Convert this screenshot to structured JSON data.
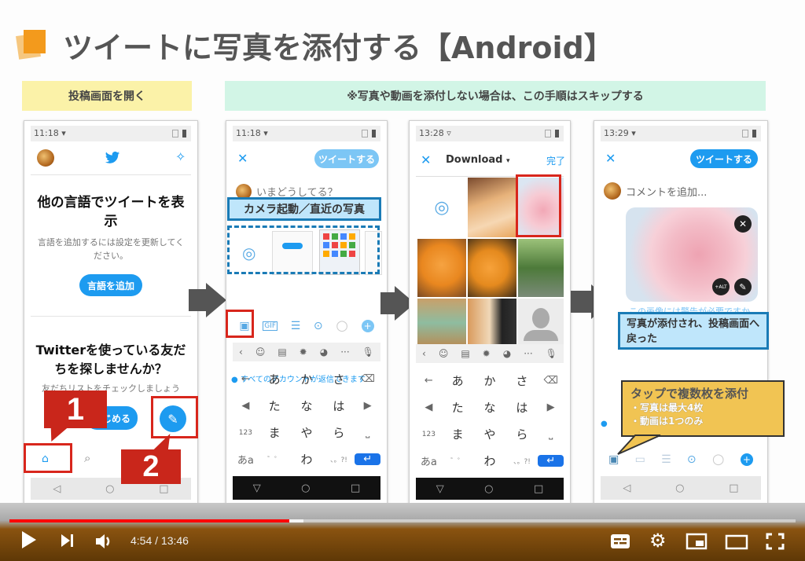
{
  "slide": {
    "title": "ツイートに写真を添付する【Android】",
    "step_banners": {
      "open_compose": "投稿画面を開く",
      "skip_note": "※写真や動画を添付しない場合は、この手順はスキップする"
    }
  },
  "phone1": {
    "status_time": "11:18",
    "card1_title": "他の言語でツイートを表示",
    "card1_desc": "言語を追加するには設定を更新してください。",
    "card1_button": "言語を追加",
    "card2_title": "Twitterを使っている友だちを探しませんか？",
    "card2_desc": "友だちリストをチェックしましょう",
    "card2_button": "はじめる",
    "callout1": "1",
    "callout2": "2",
    "nav": [
      "◁",
      "○",
      "□"
    ]
  },
  "phone2": {
    "status_time": "11:18",
    "close": "✕",
    "tweet_button": "ツイートする",
    "placeholder": "いまどうしてる？",
    "annotation": "カメラ起動／直近の写真",
    "reply_setting": "すべてのアカウントが返信できます",
    "keyboard_rows": [
      [
        "←",
        "あ",
        "か",
        "さ",
        "⌫"
      ],
      [
        "◀",
        "た",
        "な",
        "は",
        "▶"
      ],
      [
        "123",
        "ま",
        "や",
        "ら",
        "⎵"
      ],
      [
        "あa",
        "゛゜",
        "わ",
        "、。?!",
        "↵"
      ]
    ],
    "nav": [
      "▽",
      "○",
      "□"
    ]
  },
  "phone3": {
    "status_time": "13:28",
    "close": "✕",
    "folder": "Download",
    "done": "完了",
    "keyboard_rows": [
      [
        "←",
        "あ",
        "か",
        "さ",
        "⌫"
      ],
      [
        "◀",
        "た",
        "な",
        "は",
        "▶"
      ],
      [
        "123",
        "ま",
        "や",
        "ら",
        "⎵"
      ],
      [
        "あa",
        "゛゜",
        "わ",
        "、。?!",
        "↵"
      ]
    ],
    "nav": [
      "▽",
      "○",
      "□"
    ]
  },
  "phone4": {
    "status_time": "13:29",
    "close": "✕",
    "tweet_button": "ツイートする",
    "placeholder": "コメントを追加...",
    "alt_label": "+ALT",
    "hidden_text": "この画像には警告が必要ですか",
    "annotation": "写真が添付され、投稿画面へ戻った",
    "nav": [
      "◁",
      "○",
      "□"
    ]
  },
  "callout_tip": {
    "title": "タップで複数枚を添付",
    "items": [
      "・写真は最大4枚",
      "・動画は1つのみ"
    ]
  },
  "player": {
    "current_time": "4:54",
    "duration": "13:46",
    "time_display": "4:54 / 13:46",
    "progress_fraction": 0.356,
    "colors": {
      "played": "#ff0000",
      "accent": "#1d9bf0"
    }
  }
}
